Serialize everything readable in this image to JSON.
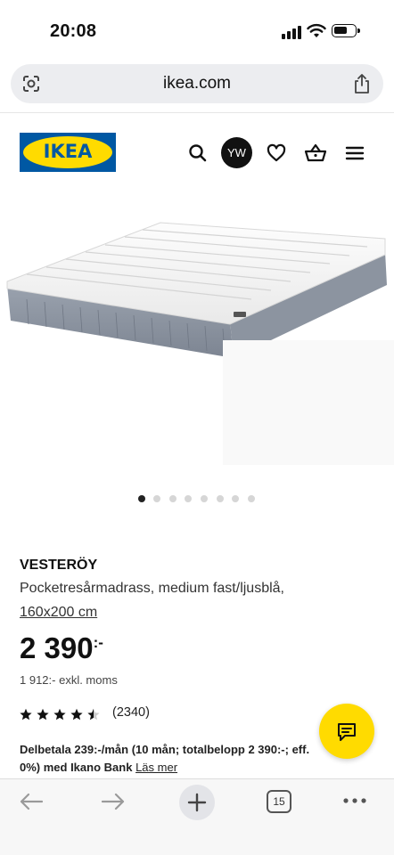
{
  "status_bar": {
    "time": "20:08"
  },
  "browser": {
    "url": "ikea.com",
    "tab_count": "15"
  },
  "header": {
    "logo_text": "IKEA",
    "avatar_initials": "YW",
    "icons": [
      "search-icon",
      "heart-icon",
      "cart-icon",
      "menu-icon"
    ]
  },
  "gallery": {
    "total_images": 8,
    "active_index": 0
  },
  "product": {
    "name": "VESTERÖY",
    "description": "Pocketresårmadrass, medium fast/ljusblå,",
    "size": "160x200 cm",
    "price_main": "2 390",
    "price_suffix": ":-",
    "price_ex_vat": "1 912:- exkl. moms",
    "rating_stars": 4.5,
    "rating_count": "(2340)",
    "finance_text": "Delbetala 239:-/mån (10 mån; totalbelopp 2 390:-; eff. 0%) med Ikano Bank",
    "finance_link": "Läs mer"
  },
  "colors": {
    "ikea_blue": "#0058a3",
    "ikea_yellow": "#ffdb00"
  }
}
